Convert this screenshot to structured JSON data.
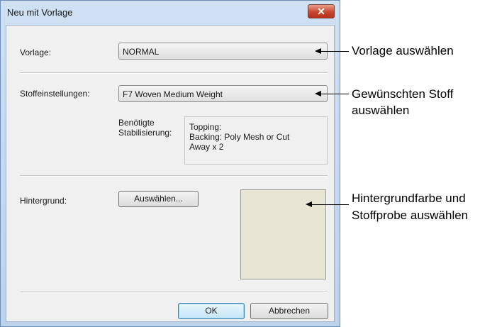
{
  "dialog": {
    "title": "Neu mit Vorlage",
    "close_icon": "close-icon",
    "template": {
      "label": "Vorlage:",
      "value": "NORMAL"
    },
    "fabric": {
      "label": "Stoffeinstellungen:",
      "value": "F7 Woven Medium Weight"
    },
    "stabilizer": {
      "label_line1": "Benötigte",
      "label_line2": "Stabilisierung:",
      "text_line1": "Topping:",
      "text_line2": "Backing: Poly Mesh or Cut",
      "text_line3": "Away x 2"
    },
    "background": {
      "label": "Hintergrund:",
      "button": "Auswählen...",
      "swatch_color": "#e8e5d4"
    },
    "ok_button": "OK",
    "cancel_button": "Abbrechen"
  },
  "annotations": {
    "template": "Vorlage auswählen",
    "fabric_line1": "Gewünschten Stoff",
    "fabric_line2": "auswählen",
    "background_line1": "Hintergrundfarbe und",
    "background_line2": "Stoffprobe auswählen"
  },
  "colors": {
    "title_bar": "#bcd1ea",
    "close_button": "#c8452f",
    "dialog_body": "#f0f0f0"
  }
}
